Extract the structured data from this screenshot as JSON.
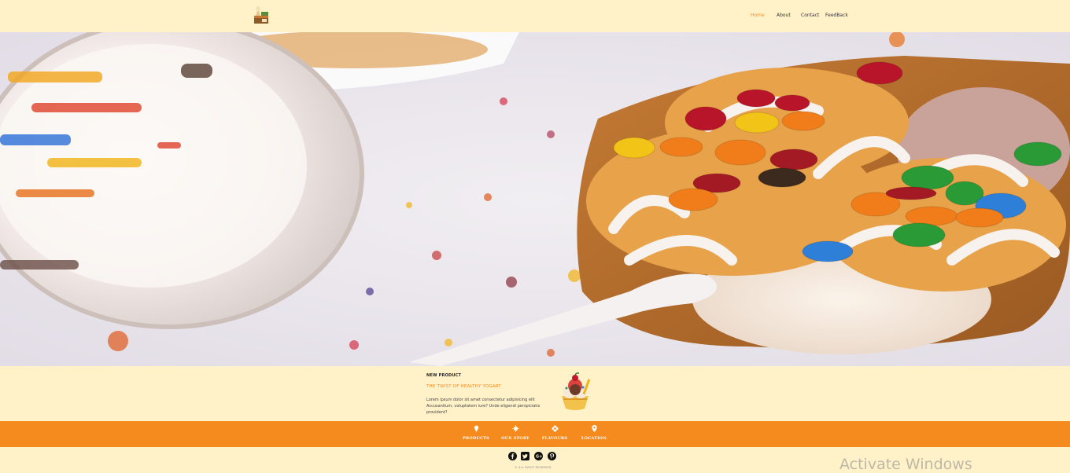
{
  "nav": {
    "home": "Home",
    "about": "About",
    "contact": "Contact",
    "feedback": "FeedBack"
  },
  "logo": {
    "icon": "ice-cream-shop-logo"
  },
  "hero": {
    "image": "ice-cream-with-candy-photo"
  },
  "product": {
    "eyebrow": "NEW PRODUCT",
    "title": "THE TWIST OF HEALTHY YOGART",
    "description": "Lorem ipsum dolor sit amet consectetur adipisicing elit Accusantium, voluptatem iure? Unde eligendi perspiciatis provident?",
    "image": "sundae-icon"
  },
  "categories": [
    {
      "label": "PRODUCTS",
      "icon": "ice-cream-cone-icon"
    },
    {
      "label": "OUR STORY",
      "icon": "sun-icon"
    },
    {
      "label": "FLAVOURS",
      "icon": "flower-icon"
    },
    {
      "label": "LOCATION",
      "icon": "map-pin-icon"
    }
  ],
  "footer": {
    "copyright": "© ALL RIGHT RESERVED",
    "socials": [
      "facebook-icon",
      "twitter-icon",
      "google-plus-icon",
      "pinterest-icon"
    ]
  },
  "watermark": "Activate Windows",
  "colors": {
    "background": "#fff2c9",
    "accent": "#f58a1f"
  }
}
